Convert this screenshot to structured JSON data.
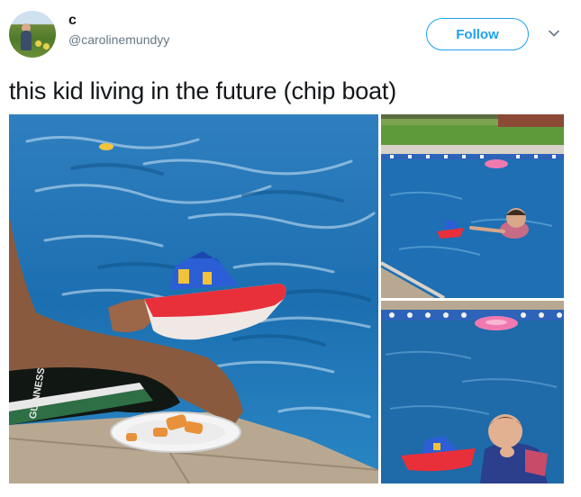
{
  "user": {
    "display_name": "c",
    "handle": "@carolinemundyy"
  },
  "follow_label": "Follow",
  "tweet": {
    "text": "this kid living in the future (chip boat)"
  },
  "photos": {
    "main_shorts_print": "GUINNESS"
  },
  "colors": {
    "accent": "#1da1f2",
    "secondary_text": "#657786",
    "pool_water": "#1c6fb0"
  },
  "icons": {
    "more": "chevron-down-icon"
  }
}
